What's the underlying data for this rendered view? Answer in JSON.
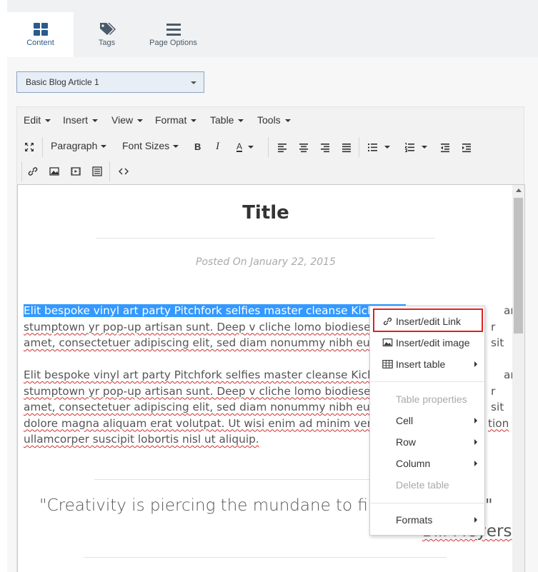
{
  "tabs": [
    {
      "label": "Content",
      "icon": "grid-icon",
      "active": true
    },
    {
      "label": "Tags",
      "icon": "tags-icon",
      "active": false
    },
    {
      "label": "Page Options",
      "icon": "hamburger-icon",
      "active": false
    }
  ],
  "template_select": {
    "value": "Basic Blog Article 1"
  },
  "menubar": [
    "Edit",
    "Insert",
    "View",
    "Format",
    "Table",
    "Tools"
  ],
  "toolbar": {
    "block_format": "Paragraph",
    "font_sizes": "Font Sizes"
  },
  "article": {
    "title": "Title",
    "posted": "Posted On January 22, 2015",
    "para1": {
      "selected": "Elit bespoke vinyl art party Pitchfork selfies master cleanse Kickstarte",
      "line1_tail": "ar",
      "line2_left": "stumptown yr pop-up artisan sunt. Deep v cliche lomo biodiesel Neu",
      "line2_right": "r sit",
      "line3_left": "amet, consectetuer adipiscing elit, sed diam nonummy nibh euismod"
    },
    "para2": {
      "line1_left": "Elit bespoke vinyl art party Pitchfork selfies master cleanse Kickstarte",
      "line1_tail": "ar",
      "line2_left": "stumptown yr pop-up artisan sunt. Deep v cliche lomo biodiesel Neu",
      "line2_right": "r sit",
      "line3_left": "amet, consectetuer adipiscing elit, sed diam nonummy nibh euismod",
      "line4_left": "dolore magna aliquam erat volutpat. Ut wisi enim ad minim veniam,",
      "line4_right": "tion",
      "line5": "ullamcorper suscipit lobortis nisl ut aliquip."
    },
    "quote": "\"Creativity is piercing the mundane to find t",
    "quote_end": "\"",
    "author": "Bill Meyers"
  },
  "context_menu": {
    "items": [
      {
        "label": "Insert/edit Link",
        "icon": "link-icon",
        "submenu": false,
        "disabled": false
      },
      {
        "label": "Insert/edit image",
        "icon": "image-icon",
        "submenu": false,
        "disabled": false
      },
      {
        "label": "Insert table",
        "icon": "table-icon",
        "submenu": true,
        "disabled": false
      },
      {
        "label": "Table properties",
        "submenu": false,
        "disabled": true
      },
      {
        "label": "Cell",
        "submenu": true,
        "disabled": false
      },
      {
        "label": "Row",
        "submenu": true,
        "disabled": false
      },
      {
        "label": "Column",
        "submenu": true,
        "disabled": false
      },
      {
        "label": "Delete table",
        "submenu": false,
        "disabled": true
      },
      {
        "label": "Formats",
        "submenu": true,
        "disabled": false
      }
    ],
    "highlight_color": "#e02020"
  },
  "colors": {
    "selection": "#3399ff",
    "tab_active_text": "#2a5b8c"
  }
}
